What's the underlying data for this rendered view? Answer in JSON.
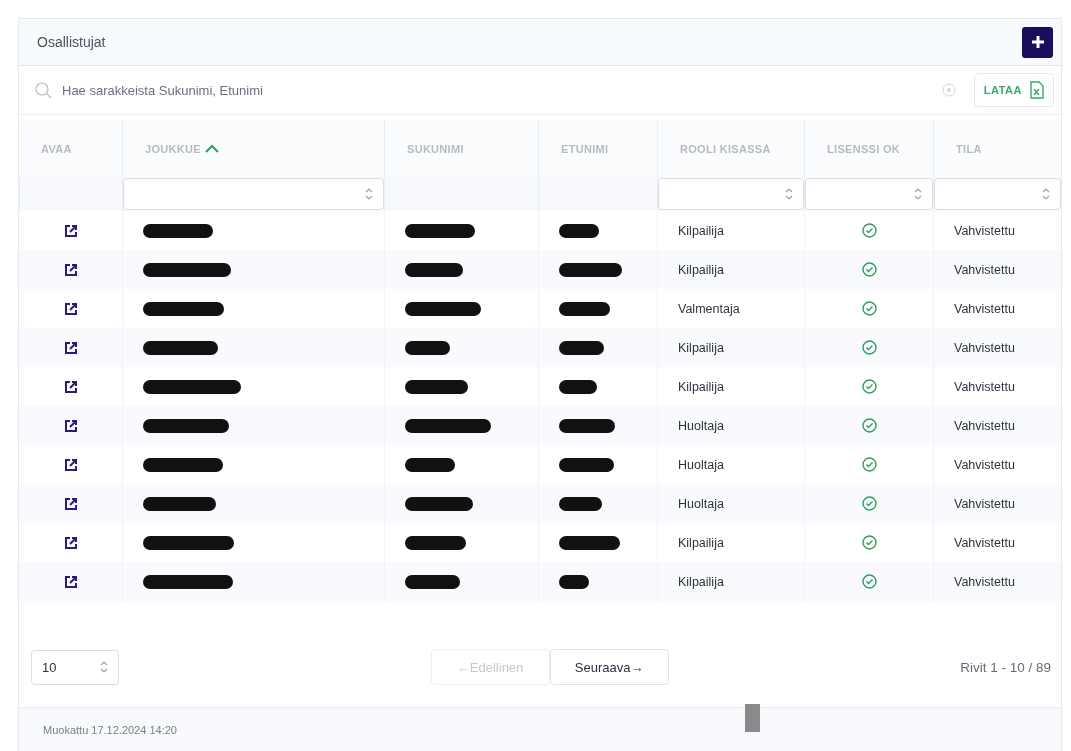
{
  "panel": {
    "title": "Osallistujat"
  },
  "search": {
    "placeholder": "Hae sarakkeista Sukunimi, Etunimi"
  },
  "download_button": {
    "label": "LATAA"
  },
  "table": {
    "columns": [
      {
        "label": "AVAA",
        "sorted": false,
        "filter": false
      },
      {
        "label": "JOUKKUE",
        "sorted": true,
        "filter": true
      },
      {
        "label": "SUKUNIMI",
        "sorted": false,
        "filter": false
      },
      {
        "label": "ETUNIMI",
        "sorted": false,
        "filter": false
      },
      {
        "label": "ROOLI KISASSA",
        "sorted": false,
        "filter": true
      },
      {
        "label": "LISENSSI OK",
        "sorted": false,
        "filter": true
      },
      {
        "label": "TILA",
        "sorted": false,
        "filter": true
      }
    ],
    "rows": [
      {
        "role": "Kilpailija",
        "license_ok": true,
        "status": "Vahvistettu"
      },
      {
        "role": "Kilpailija",
        "license_ok": true,
        "status": "Vahvistettu"
      },
      {
        "role": "Valmentaja",
        "license_ok": true,
        "status": "Vahvistettu"
      },
      {
        "role": "Kilpailija",
        "license_ok": true,
        "status": "Vahvistettu"
      },
      {
        "role": "Kilpailija",
        "license_ok": true,
        "status": "Vahvistettu"
      },
      {
        "role": "Huoltaja",
        "license_ok": true,
        "status": "Vahvistettu"
      },
      {
        "role": "Huoltaja",
        "license_ok": true,
        "status": "Vahvistettu"
      },
      {
        "role": "Huoltaja",
        "license_ok": true,
        "status": "Vahvistettu"
      },
      {
        "role": "Kilpailija",
        "license_ok": true,
        "status": "Vahvistettu"
      },
      {
        "role": "Kilpailija",
        "license_ok": true,
        "status": "Vahvistettu"
      }
    ]
  },
  "pagination": {
    "page_size": "10",
    "previous": {
      "label": "←Edellinen",
      "disabled": true
    },
    "next": {
      "label": "Seuraava→",
      "disabled": false
    },
    "range": "Rivit 1 - 10 / 89"
  },
  "footer": {
    "modified": "Muokattu 17.12.2024 14:20"
  }
}
